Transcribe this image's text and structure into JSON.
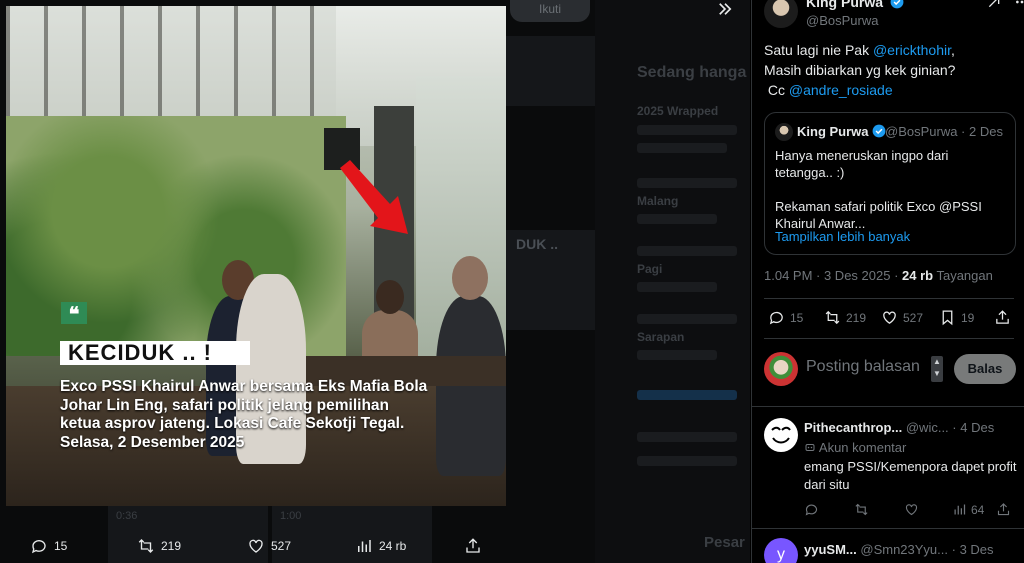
{
  "backdrop": {
    "follow_label": "Ikuti",
    "trending_heading": "Sedang hanga",
    "trends": [
      "2025 Wrapped",
      "Malang",
      "Pagi",
      "Sarapan"
    ],
    "video_text": "DUK ..",
    "bottom_label": "Pesar",
    "durations": [
      "0:36",
      "1:00"
    ]
  },
  "collapse_icon": "chevrons-right-icon",
  "video": {
    "badge": "❝",
    "title": "KECIDUK .. !",
    "caption_lines": [
      "Exco PSSI Khairul Anwar bersama Eks Mafia Bola",
      "Johar Lin Eng, safari politik jelang pemilihan",
      "ketua asprov jateng. Lokasi Cafe Sekotji Tegal.",
      "Selasa, 2 Desember  2025"
    ]
  },
  "media_actions": {
    "replies": "15",
    "reposts": "219",
    "likes": "527",
    "views": "24 rb"
  },
  "tweet": {
    "author_name": "King Purwa",
    "author_handle": "@BosPurwa",
    "text_1": "Satu lagi nie Pak ",
    "mention_1": "@erickthohir",
    "text_1_end": ",",
    "text_2": "Masih dibiarkan yg kek ginian?",
    "text_3": " Cc ",
    "mention_2": "@andre_rosiade",
    "time": "1.04 PM · 3 Des 2025 · ",
    "views_count": "24 rb",
    "views_label": " Tayangan",
    "stats": {
      "replies": "15",
      "reposts": "219",
      "likes": "527",
      "bookmarks": "19"
    }
  },
  "quote": {
    "name": "King Purwa",
    "handle_date": "@BosPurwa · 2 Des",
    "para1": "Hanya meneruskan ingpo dari tetangga.. :)",
    "para2": "Rekaman safari politik Exco @PSSI Khairul Anwar...",
    "more": "Tampilkan lebih banyak"
  },
  "reply": {
    "placeholder": "Posting balasan",
    "button": "Balas"
  },
  "comments": [
    {
      "name": "Pithecanthrop...",
      "handle": "@wic...",
      "date": "· 4 Des",
      "badge": "Akun komentar",
      "text": "emang PSSI/Kemenpora dapet profit dari situ",
      "views": "64"
    },
    {
      "name": "yyuSM...",
      "handle": "@Smn23Yyu...",
      "date": "· 3 Des"
    }
  ],
  "colors": {
    "accent": "#1d9bf0",
    "muted": "#71767b",
    "text": "#e7e9ea",
    "border": "#2f3336"
  }
}
